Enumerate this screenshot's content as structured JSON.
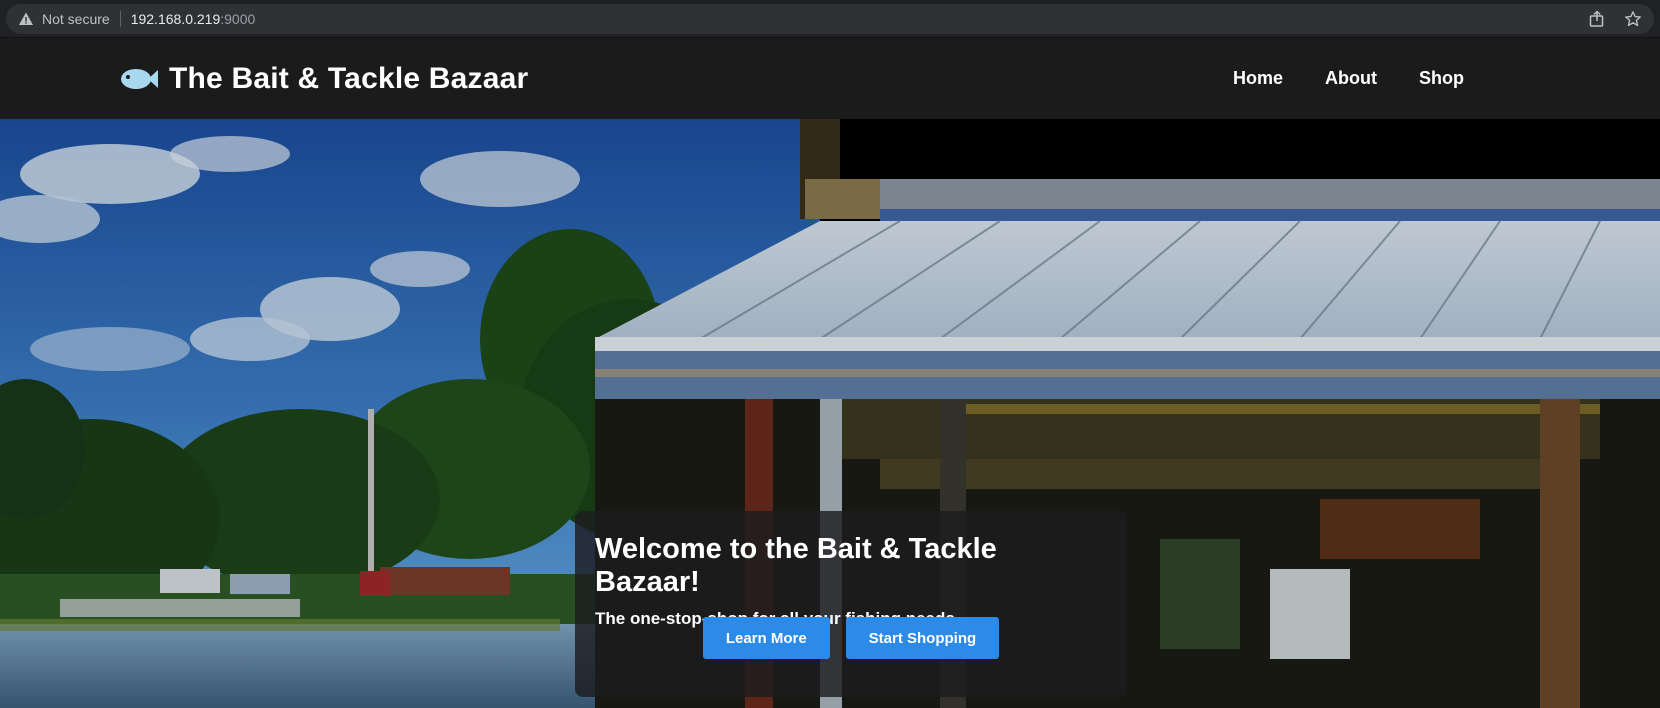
{
  "browser": {
    "security_label": "Not secure",
    "url_host": "192.168.0.219",
    "url_port": ":9000",
    "icons": [
      "warning-icon",
      "share-icon",
      "star-icon"
    ]
  },
  "header": {
    "logo_icon": "fish-icon",
    "title": "The Bait & Tackle Bazaar",
    "nav": [
      {
        "label": "Home"
      },
      {
        "label": "About"
      },
      {
        "label": "Shop"
      }
    ]
  },
  "hero": {
    "title": "Welcome to the Bait & Tackle Bazaar!",
    "subtitle": "The one-stop-shop for all your fishing needs",
    "buttons": [
      {
        "label": "Learn More"
      },
      {
        "label": "Start Shopping"
      }
    ]
  },
  "colors": {
    "header_bg": "#1c1b1c",
    "button_bg": "#2c8be9",
    "fish_icon": "#a8d8f0"
  }
}
